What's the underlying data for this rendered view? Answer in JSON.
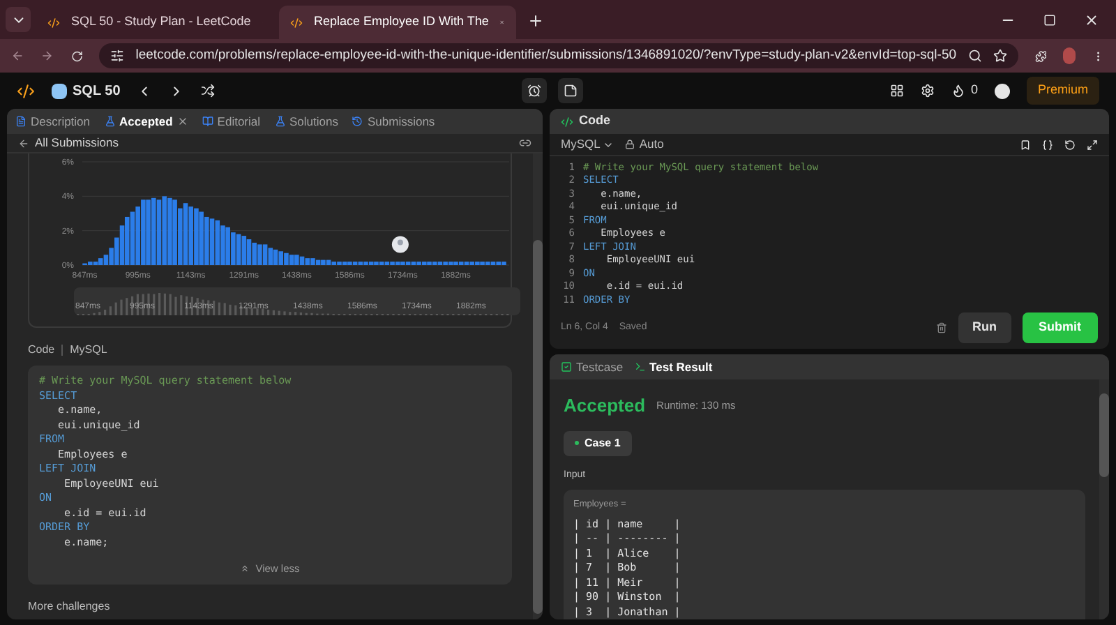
{
  "browser": {
    "tabs": [
      {
        "title": "SQL 50 - Study Plan - LeetCode",
        "selected": false
      },
      {
        "title": "Replace Employee ID With The",
        "selected": true
      }
    ],
    "url": "leetcode.com/problems/replace-employee-id-with-the-unique-identifier/submissions/1346891020/?envType=study-plan-v2&envId=top-sql-50"
  },
  "nav": {
    "title": "SQL 50",
    "streak": "0",
    "premium": "Premium"
  },
  "left_panel": {
    "tabs": [
      {
        "label": "Description",
        "selected": false,
        "closable": false
      },
      {
        "label": "Accepted",
        "selected": true,
        "closable": true
      },
      {
        "label": "Editorial",
        "selected": false,
        "closable": false
      },
      {
        "label": "Solutions",
        "selected": false,
        "closable": false
      },
      {
        "label": "Submissions",
        "selected": false,
        "closable": false
      }
    ],
    "back_link": "All Submissions",
    "chart_data": {
      "type": "bar",
      "yticks": [
        {
          "value": 0,
          "label": "0%"
        },
        {
          "value": 2,
          "label": "2%"
        },
        {
          "value": 4,
          "label": "4%"
        },
        {
          "value": 6,
          "label": "6%"
        }
      ],
      "ylim": [
        0,
        6
      ],
      "x": [
        847,
        862,
        877,
        891,
        906,
        921,
        936,
        951,
        965,
        980,
        995,
        1010,
        1024,
        1039,
        1054,
        1069,
        1084,
        1098,
        1113,
        1128,
        1143,
        1158,
        1172,
        1187,
        1202,
        1217,
        1232,
        1246,
        1261,
        1276,
        1291,
        1305,
        1320,
        1335,
        1350,
        1365,
        1379,
        1394,
        1409,
        1424,
        1438,
        1453,
        1468,
        1483,
        1498,
        1512,
        1527,
        1542,
        1557,
        1572,
        1586,
        1601,
        1616,
        1631,
        1646,
        1660,
        1675,
        1690,
        1705,
        1720,
        1734,
        1749,
        1764,
        1779,
        1794,
        1808,
        1823,
        1838,
        1853,
        1868,
        1882,
        1897,
        1912,
        1927,
        1942,
        1956,
        1971,
        1986,
        2001,
        2016
      ],
      "xlim": [
        840,
        2023
      ],
      "xticks": [
        {
          "value": 847,
          "label": "847ms"
        },
        {
          "value": 995,
          "label": "995ms"
        },
        {
          "value": 1143,
          "label": "1143ms"
        },
        {
          "value": 1291,
          "label": "1291ms"
        },
        {
          "value": 1438,
          "label": "1438ms"
        },
        {
          "value": 1586,
          "label": "1586ms"
        },
        {
          "value": 1734,
          "label": "1734ms"
        },
        {
          "value": 1882,
          "label": "1882ms"
        }
      ],
      "values": [
        0.1,
        0.2,
        0.2,
        0.4,
        0.6,
        1.0,
        1.6,
        2.3,
        2.8,
        3.1,
        3.4,
        3.8,
        3.8,
        3.9,
        3.8,
        4.0,
        3.9,
        3.8,
        3.3,
        3.6,
        3.4,
        3.3,
        3.1,
        2.8,
        2.7,
        2.6,
        2.3,
        2.2,
        1.9,
        1.8,
        1.7,
        1.5,
        1.3,
        1.2,
        1.2,
        1.0,
        0.9,
        0.8,
        0.7,
        0.6,
        0.6,
        0.5,
        0.4,
        0.4,
        0.3,
        0.3,
        0.3,
        0.2,
        0.2,
        0.2,
        0.2,
        0.2,
        0.2,
        0.2,
        0.2,
        0.2,
        0.2,
        0.2,
        0.2,
        0.2,
        0.2,
        0.2,
        0.2,
        0.2,
        0.2,
        0.2,
        0.2,
        0.2,
        0.2,
        0.2,
        0.2,
        0.2,
        0.2,
        0.2,
        0.2,
        0.2,
        0.2,
        0.2,
        0.2,
        0.2
      ]
    },
    "overview_labels": [
      "847ms",
      "995ms",
      "1143ms",
      "1291ms",
      "1438ms",
      "1586ms",
      "1734ms",
      "1882ms"
    ],
    "code_label": "Code",
    "code_language": "MySQL",
    "code_lines": [
      {
        "text": "# Write your MySQL query statement below",
        "kind": "comment"
      },
      {
        "text": "SELECT",
        "kind": "keyword"
      },
      {
        "text": "   e.name,",
        "kind": "plain"
      },
      {
        "text": "   eui.unique_id",
        "kind": "plain"
      },
      {
        "text": "FROM",
        "kind": "keyword"
      },
      {
        "text": "   Employees e",
        "kind": "plain"
      },
      {
        "text": "LEFT JOIN",
        "kind": "keyword"
      },
      {
        "text": "    EmployeeUNI eui",
        "kind": "plain"
      },
      {
        "text": "ON",
        "kind": "keyword"
      },
      {
        "text": "    e.id = eui.id",
        "kind": "plain"
      },
      {
        "text": "ORDER BY",
        "kind": "keyword"
      },
      {
        "text": "    e.name;",
        "kind": "plain"
      }
    ],
    "view_toggle": "View less",
    "more": "More challenges"
  },
  "editor": {
    "title": "Code",
    "language": "MySQL",
    "mode": "Auto",
    "lines": [
      {
        "number": "1",
        "text": "# Write your MySQL query statement below",
        "kind": "comment"
      },
      {
        "number": "2",
        "text": "SELECT",
        "kind": "keyword"
      },
      {
        "number": "3",
        "text": "   e.name,",
        "kind": "plain"
      },
      {
        "number": "4",
        "text": "   eui.unique_id",
        "kind": "plain"
      },
      {
        "number": "5",
        "text": "FROM",
        "kind": "keyword"
      },
      {
        "number": "6",
        "text": "   Employees e",
        "kind": "plain"
      },
      {
        "number": "7",
        "text": "LEFT JOIN",
        "kind": "keyword"
      },
      {
        "number": "8",
        "text": "    EmployeeUNI eui",
        "kind": "plain"
      },
      {
        "number": "9",
        "text": "ON",
        "kind": "keyword"
      },
      {
        "number": "10",
        "text": "    e.id = eui.id",
        "kind": "plain"
      },
      {
        "number": "11",
        "text": "ORDER BY",
        "kind": "keyword"
      }
    ],
    "cursor": "Ln 6, Col 4",
    "saved": "Saved",
    "run": "Run",
    "submit": "Submit"
  },
  "result": {
    "tabs": [
      {
        "label": "Testcase",
        "selected": false
      },
      {
        "label": "Test Result",
        "selected": true
      }
    ],
    "status": "Accepted",
    "runtime": "Runtime: 130 ms",
    "cases": [
      {
        "label": "Case 1",
        "selected": true
      }
    ],
    "input_label": "Input",
    "param": "Employees =",
    "table_lines": [
      "| id | name     |",
      "| -- | -------- |",
      "| 1  | Alice    |",
      "| 7  | Bob      |",
      "| 11 | Meir     |",
      "| 90 | Winston  |",
      "| 3  | Jonathan |"
    ]
  }
}
